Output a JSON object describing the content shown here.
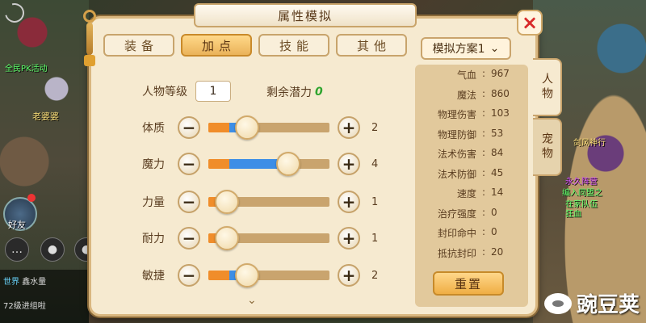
{
  "background": {
    "npc_tags": [
      "全民PK活动",
      "老婆婆"
    ],
    "right_tags": [
      "剑风神行",
      "永久阵营",
      "编入同盟之",
      "在家队伍",
      "狂血"
    ],
    "friend_label": "好友",
    "chat": {
      "line1_channel": "世界",
      "line1_text": "鑫水量",
      "line2_text": "72级进组啦"
    },
    "watermark": "豌豆荚"
  },
  "panel": {
    "title": "属性模拟",
    "close_icon": "×",
    "tabs": [
      "装备",
      "加点",
      "技能",
      "其他"
    ],
    "active_tab": "加点",
    "scheme_label": "模拟方案1",
    "level_label": "人物等级",
    "level_value": "1",
    "potential_label": "剩余潜力",
    "potential_value": "0",
    "stats": [
      {
        "name": "体质",
        "value": "2",
        "orange_fill": 0.17,
        "blue_fill": 0.15,
        "knob": 0.32
      },
      {
        "name": "魔力",
        "value": "4",
        "orange_fill": 0.17,
        "blue_fill": 0.49,
        "knob": 0.66
      },
      {
        "name": "力量",
        "value": "1",
        "orange_fill": 0.14,
        "blue_fill": 0.0,
        "knob": 0.15
      },
      {
        "name": "耐力",
        "value": "1",
        "orange_fill": 0.14,
        "blue_fill": 0.0,
        "knob": 0.15
      },
      {
        "name": "敏捷",
        "value": "2",
        "orange_fill": 0.17,
        "blue_fill": 0.15,
        "knob": 0.32
      }
    ],
    "info": [
      {
        "key": "气血",
        "value": "967"
      },
      {
        "key": "魔法",
        "value": "860"
      },
      {
        "key": "物理伤害",
        "value": "103"
      },
      {
        "key": "物理防御",
        "value": "53"
      },
      {
        "key": "法术伤害",
        "value": "84"
      },
      {
        "key": "法术防御",
        "value": "45"
      },
      {
        "key": "速度",
        "value": "14"
      },
      {
        "key": "治疗强度",
        "value": "0"
      },
      {
        "key": "封印命中",
        "value": "0"
      },
      {
        "key": "抵抗封印",
        "value": "20"
      }
    ],
    "reset_label": "重置",
    "side_tabs": [
      "人物",
      "宠物"
    ],
    "active_side_tab": "人物"
  }
}
